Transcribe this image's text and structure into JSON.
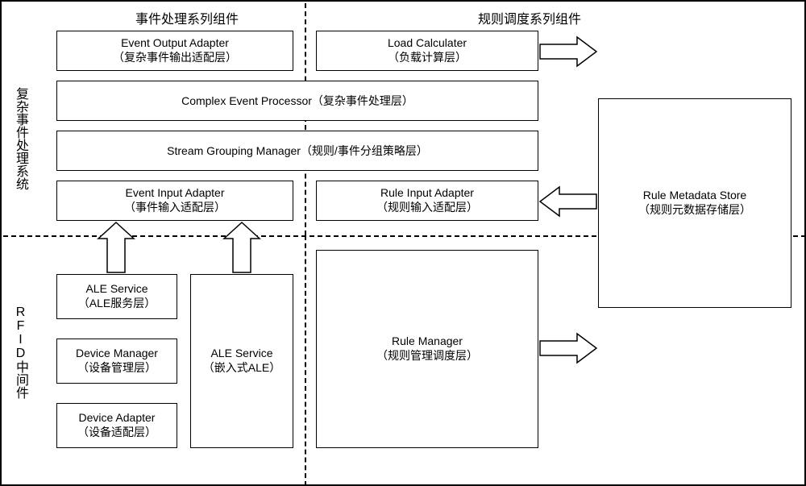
{
  "headers": {
    "left": "事件处理系列组件",
    "right": "规则调度系列组件"
  },
  "vlabels": {
    "system": "复杂事件处理系统",
    "middleware": "RFID中间件"
  },
  "boxes": {
    "eventOutputAdapter": {
      "en": "Event Output Adapter",
      "zh": "（复杂事件输出适配层）"
    },
    "loadCalculater": {
      "en": "Load Calculater",
      "zh": "（负载计算层）"
    },
    "complexEventProcessor": {
      "en": "Complex Event Processor",
      "zh": "（复杂事件处理层）"
    },
    "streamGroupingManager": {
      "en": "Stream Grouping Manager",
      "zh": "（规则/事件分组策略层）"
    },
    "eventInputAdapter": {
      "en": "Event Input Adapter",
      "zh": "（事件输入适配层）"
    },
    "ruleInputAdapter": {
      "en": "Rule Input Adapter",
      "zh": "（规则输入适配层）"
    },
    "ruleMetadataStore": {
      "en": "Rule Metadata Store",
      "zh": "（规则元数据存储层）"
    },
    "aleService": {
      "en": "ALE Service",
      "zh": "（ALE服务层）"
    },
    "deviceManager": {
      "en": "Device Manager",
      "zh": "（设备管理层）"
    },
    "deviceAdapter": {
      "en": "Device Adapter",
      "zh": "（设备适配层）"
    },
    "aleServiceEmbedded": {
      "en": "ALE Service",
      "zh": "（嵌入式ALE）"
    },
    "ruleManager": {
      "en": "Rule Manager",
      "zh": "（规则管理调度层）"
    }
  }
}
